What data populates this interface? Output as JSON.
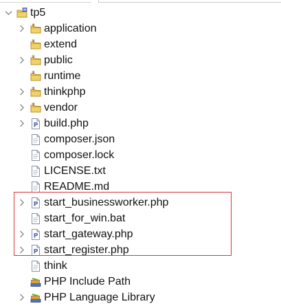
{
  "tree": {
    "project": {
      "name": "tp5",
      "expanded": true,
      "icon": "php-project-folder-icon"
    },
    "items": [
      {
        "label": "application",
        "icon": "package-folder-icon",
        "expandable": true
      },
      {
        "label": "extend",
        "icon": "package-folder-icon",
        "expandable": false
      },
      {
        "label": "public",
        "icon": "package-folder-icon",
        "expandable": true
      },
      {
        "label": "runtime",
        "icon": "package-folder-icon",
        "expandable": false
      },
      {
        "label": "thinkphp",
        "icon": "package-folder-icon",
        "expandable": true
      },
      {
        "label": "vendor",
        "icon": "package-folder-icon",
        "expandable": true
      },
      {
        "label": "build.php",
        "icon": "php-file-icon",
        "expandable": true
      },
      {
        "label": "composer.json",
        "icon": "text-file-icon",
        "expandable": false
      },
      {
        "label": "composer.lock",
        "icon": "text-file-icon",
        "expandable": false
      },
      {
        "label": "LICENSE.txt",
        "icon": "text-file-icon",
        "expandable": false
      },
      {
        "label": "README.md",
        "icon": "text-file-icon",
        "expandable": false
      },
      {
        "label": "start_businessworker.php",
        "icon": "php-file-icon",
        "expandable": true
      },
      {
        "label": "start_for_win.bat",
        "icon": "text-file-icon",
        "expandable": false
      },
      {
        "label": "start_gateway.php",
        "icon": "php-file-icon",
        "expandable": true
      },
      {
        "label": "start_register.php",
        "icon": "php-file-icon",
        "expandable": true
      },
      {
        "label": "think",
        "icon": "text-file-icon",
        "expandable": false
      },
      {
        "label": "PHP Include Path",
        "icon": "library-icon",
        "expandable": false
      },
      {
        "label": "PHP Language Library",
        "icon": "library-icon",
        "expandable": true
      }
    ]
  },
  "colors": {
    "highlight_border": "#d9363e",
    "chevron": "#8a8a8a",
    "folder_fill": "#f2d16b",
    "folder_stroke": "#b9902a",
    "php_file_badge": "#4a64a8"
  }
}
